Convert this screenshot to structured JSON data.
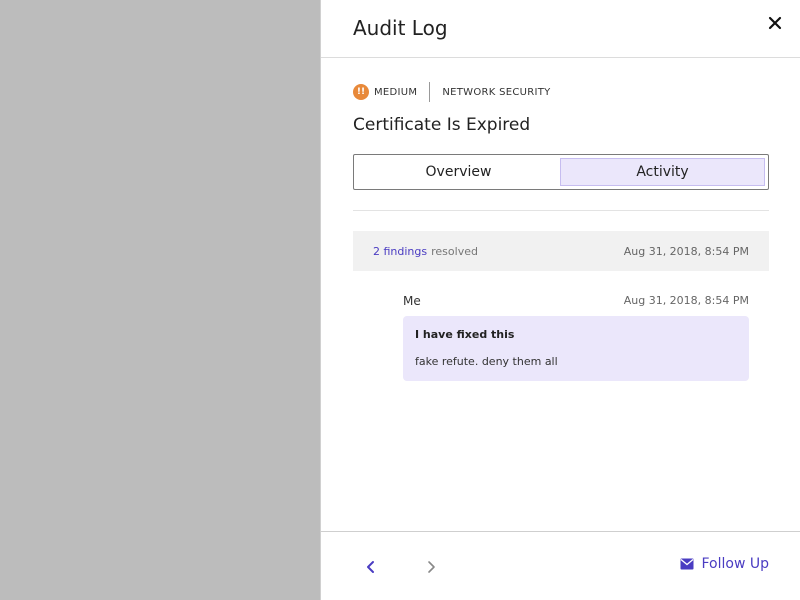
{
  "panel": {
    "title": "Audit Log"
  },
  "issue": {
    "severity_label": "MEDIUM",
    "severity_icon_text": "!!",
    "severity_color": "#e8893a",
    "category": "NETWORK SECURITY",
    "title": "Certificate Is Expired"
  },
  "tabs": [
    {
      "label": "Overview",
      "active": false
    },
    {
      "label": "Activity",
      "active": true
    }
  ],
  "activity": {
    "event": {
      "link_text": "2 findings",
      "action": "resolved",
      "timestamp": "Aug 31, 2018, 8:54 PM"
    },
    "comment": {
      "author": "Me",
      "timestamp": "Aug 31, 2018, 8:54 PM",
      "title": "I have fixed this",
      "body": "fake refute. deny them all"
    }
  },
  "footer": {
    "follow_up_label": "Follow Up"
  },
  "colors": {
    "accent": "#4a3cc2",
    "highlight": "#ebe7fb"
  },
  "icons": {
    "close": "close-icon",
    "prev": "chevron-left-icon",
    "next": "chevron-right-icon",
    "follow": "envelope-icon"
  }
}
